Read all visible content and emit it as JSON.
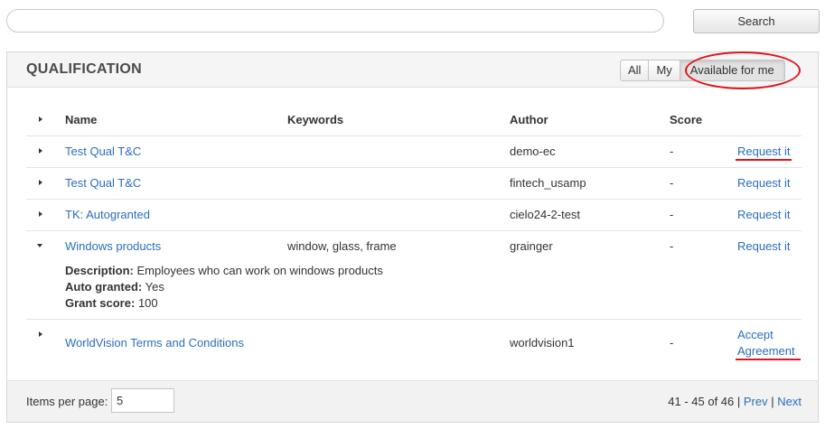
{
  "search": {
    "placeholder": "",
    "button_label": "Search"
  },
  "panel": {
    "title": "QUALIFICATION",
    "filters": [
      {
        "label": "All",
        "active": false
      },
      {
        "label": "My",
        "active": false
      },
      {
        "label": "Available for me",
        "active": true
      }
    ]
  },
  "table": {
    "columns": {
      "name": "Name",
      "keywords": "Keywords",
      "author": "Author",
      "score": "Score"
    },
    "rows": [
      {
        "name": "Test Qual T&C",
        "keywords": "",
        "author": "demo-ec",
        "score": "-",
        "action": "Request it",
        "expanded": false
      },
      {
        "name": "Test Qual T&C",
        "keywords": "",
        "author": "fintech_usamp",
        "score": "-",
        "action": "Request it",
        "expanded": false
      },
      {
        "name": "TK: Autogranted",
        "keywords": "",
        "author": "cielo24-2-test",
        "score": "-",
        "action": "Request it",
        "expanded": false
      },
      {
        "name": "Windows products",
        "keywords": "window, glass, frame",
        "author": "grainger",
        "score": "-",
        "action": "Request it",
        "expanded": true,
        "details": {
          "description_label": "Description:",
          "description": "Employees who can work on windows products",
          "auto_granted_label": "Auto granted:",
          "auto_granted": "Yes",
          "grant_score_label": "Grant score:",
          "grant_score": "100"
        }
      },
      {
        "name": "WorldVision Terms and Conditions",
        "keywords": "",
        "author": "worldvision1",
        "score": "-",
        "action_line1": "Accept",
        "action_line2": "Agreement",
        "expanded": false
      }
    ]
  },
  "footer": {
    "items_per_page_label": "Items per page:",
    "items_per_page_value": "5",
    "range_text": "41 - 45 of 46",
    "separator": "|",
    "prev_label": "Prev",
    "next_label": "Next"
  },
  "annotation_color": "#e0141b",
  "link_color": "#2a6ebb"
}
